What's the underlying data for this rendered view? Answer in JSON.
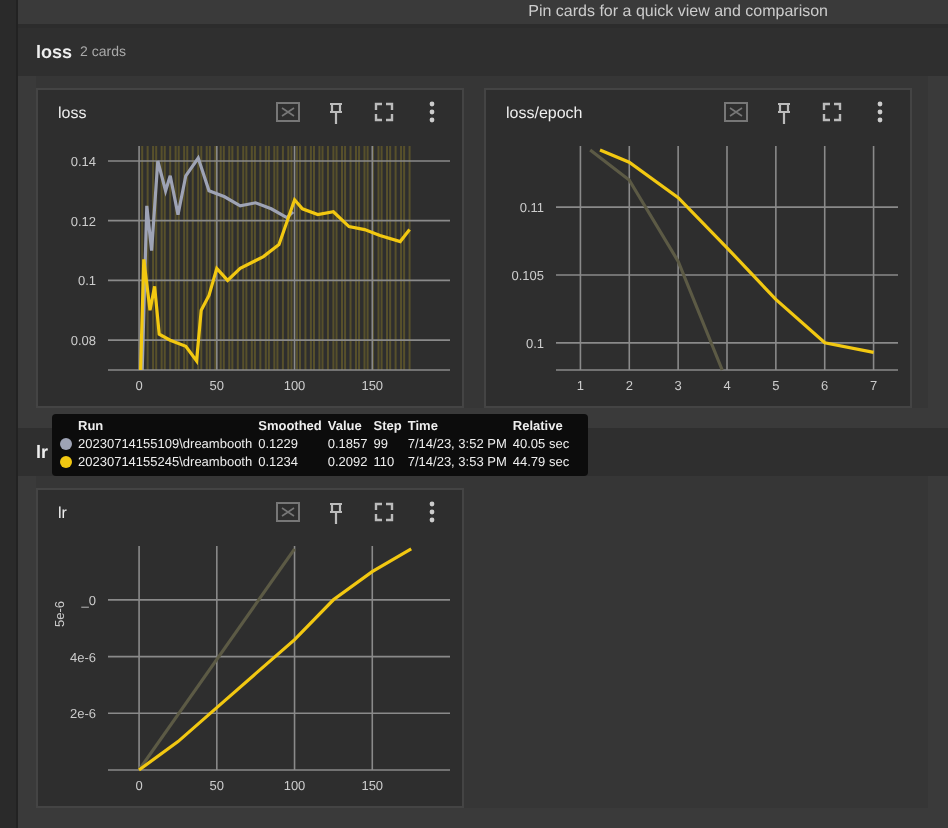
{
  "header": {
    "hint": "Pin cards for a quick view and comparison"
  },
  "sections": [
    {
      "title": "loss",
      "count": "2 cards",
      "cards": [
        {
          "title": "loss",
          "raw_overlay": true,
          "chart_data": {
            "type": "line",
            "grid": true,
            "xlim": [
              -20,
              200
            ],
            "ylim": [
              0.07,
              0.145
            ],
            "xticks": [
              0,
              50,
              100,
              150
            ],
            "yticks": [
              0.08,
              0.1,
              0.12,
              0.14
            ],
            "series": [
              {
                "color": "#9ea3b5",
                "x": [
                  2,
                  5,
                  8,
                  12,
                  17,
                  20,
                  25,
                  30,
                  38,
                  45,
                  55,
                  65,
                  75,
                  85,
                  95,
                  99
                ],
                "values": [
                  0.07,
                  0.125,
                  0.11,
                  0.14,
                  0.13,
                  0.135,
                  0.122,
                  0.135,
                  0.141,
                  0.13,
                  0.128,
                  0.125,
                  0.126,
                  0.124,
                  0.121,
                  0.123
                ]
              },
              {
                "color": "#f2c811",
                "x": [
                  1,
                  3,
                  7,
                  10,
                  13,
                  20,
                  30,
                  37,
                  40,
                  45,
                  50,
                  57,
                  65,
                  80,
                  90,
                  100,
                  105,
                  115,
                  125,
                  135,
                  145,
                  155,
                  168,
                  174
                ],
                "values": [
                  0.07,
                  0.107,
                  0.09,
                  0.098,
                  0.082,
                  0.08,
                  0.078,
                  0.073,
                  0.09,
                  0.095,
                  0.104,
                  0.1,
                  0.104,
                  0.108,
                  0.112,
                  0.127,
                  0.124,
                  0.122,
                  0.123,
                  0.118,
                  0.117,
                  0.115,
                  0.113,
                  0.117
                ]
              }
            ]
          }
        },
        {
          "title": "loss/epoch",
          "raw_overlay": false,
          "chart_data": {
            "type": "line",
            "grid": true,
            "xlim": [
              0.5,
              7.5
            ],
            "ylim": [
              0.098,
              0.1145
            ],
            "xticks": [
              1,
              2,
              3,
              4,
              5,
              6,
              7
            ],
            "yticks": [
              0.1,
              0.105,
              0.11
            ],
            "series": [
              {
                "color": "#5c5a45",
                "x": [
                  1.2,
                  2,
                  3,
                  3.9
                ],
                "values": [
                  0.1142,
                  0.112,
                  0.106,
                  0.098
                ]
              },
              {
                "color": "#f2c811",
                "x": [
                  1.4,
                  2,
                  3,
                  4,
                  5,
                  6,
                  7
                ],
                "values": [
                  0.1142,
                  0.1133,
                  0.1107,
                  0.107,
                  0.1032,
                  0.1,
                  0.0993
                ]
              }
            ]
          }
        }
      ]
    },
    {
      "title": "lr",
      "cards": [
        {
          "title": "lr",
          "raw_overlay": false,
          "chart_data": {
            "type": "line",
            "grid": true,
            "ylabel": "5e-6",
            "xlim": [
              -20,
              200
            ],
            "ylim": [
              0,
              7.9e-06
            ],
            "xticks": [
              0,
              50,
              100,
              150
            ],
            "yticks": [
              {
                "value": 2e-06,
                "label": "2e-6"
              },
              {
                "value": 4e-06,
                "label": "4e-6"
              },
              {
                "value": 6e-06,
                "label": "_0"
              }
            ],
            "series": [
              {
                "color": "#5c5a45",
                "x": [
                  0,
                  100
                ],
                "values": [
                  0,
                  7.8e-06
                ]
              },
              {
                "color": "#f2c811",
                "x": [
                  0,
                  25,
                  50,
                  75,
                  100,
                  125,
                  150,
                  175
                ],
                "values": [
                  0,
                  1e-06,
                  2.2e-06,
                  3.4e-06,
                  4.6e-06,
                  6e-06,
                  7e-06,
                  7.8e-06
                ]
              }
            ]
          }
        }
      ]
    }
  ],
  "tooltip": {
    "columns": [
      "Run",
      "Smoothed",
      "Value",
      "Step",
      "Time",
      "Relative"
    ],
    "rows": [
      {
        "color": "#9ea3b5",
        "cells": [
          "20230714155109\\dreambooth",
          "0.1229",
          "0.1857",
          "99",
          "7/14/23, 3:52 PM",
          "40.05 sec"
        ]
      },
      {
        "color": "#f2c811",
        "cells": [
          "20230714155245\\dreambooth",
          "0.1234",
          "0.2092",
          "110",
          "7/14/23, 3:53 PM",
          "44.79 sec"
        ]
      }
    ]
  }
}
